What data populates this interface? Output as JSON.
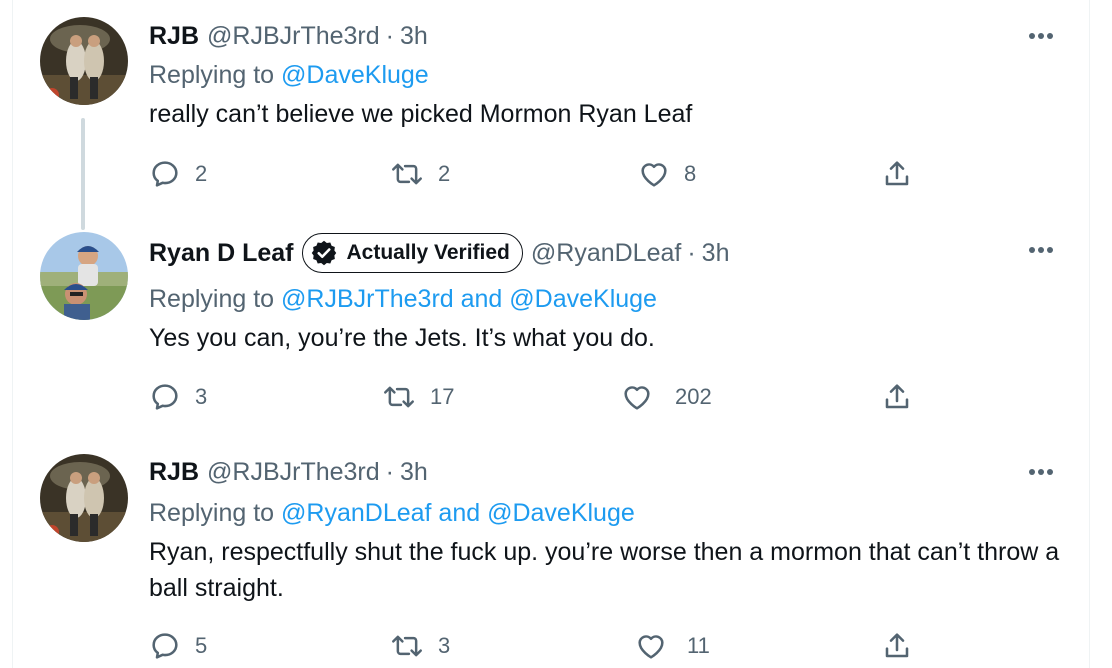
{
  "tweets": [
    {
      "name": "RJB",
      "handle": "@RJBJrThe3rd",
      "dot": "·",
      "time": "3h",
      "replying_prefix": "Replying to",
      "replying_to": "@DaveKluge",
      "text": "really can’t believe we picked Mormon Ryan Leaf",
      "replies": "2",
      "retweets": "2",
      "likes": "8"
    },
    {
      "name": "Ryan D Leaf",
      "badge_label": "Actually Verified",
      "handle": "@RyanDLeaf",
      "dot": "·",
      "time": "3h",
      "replying_prefix": "Replying to",
      "replying_to": "@RJBJrThe3rd and @DaveKluge",
      "text": "Yes you can, you’re the Jets. It’s what you do.",
      "replies": "3",
      "retweets": "17",
      "likes": "202"
    },
    {
      "name": "RJB",
      "handle": "@RJBJrThe3rd",
      "dot": "·",
      "time": "3h",
      "replying_prefix": "Replying to",
      "replying_to": "@RyanDLeaf and @DaveKluge",
      "text": "Ryan, respectfully shut the fuck up. you’re worse then a mormon that can’t throw a ball straight.",
      "replies": "5",
      "retweets": "3",
      "likes": "11"
    }
  ],
  "icons": {
    "reply": "reply-icon",
    "retweet": "retweet-icon",
    "like": "heart-icon",
    "share": "share-icon",
    "more": "more-icon",
    "badge": "verified-badge-icon"
  },
  "colors": {
    "text": "#0f1419",
    "secondary": "#536471",
    "link": "#1d9bf0",
    "thread_line": "#cfd9de"
  }
}
